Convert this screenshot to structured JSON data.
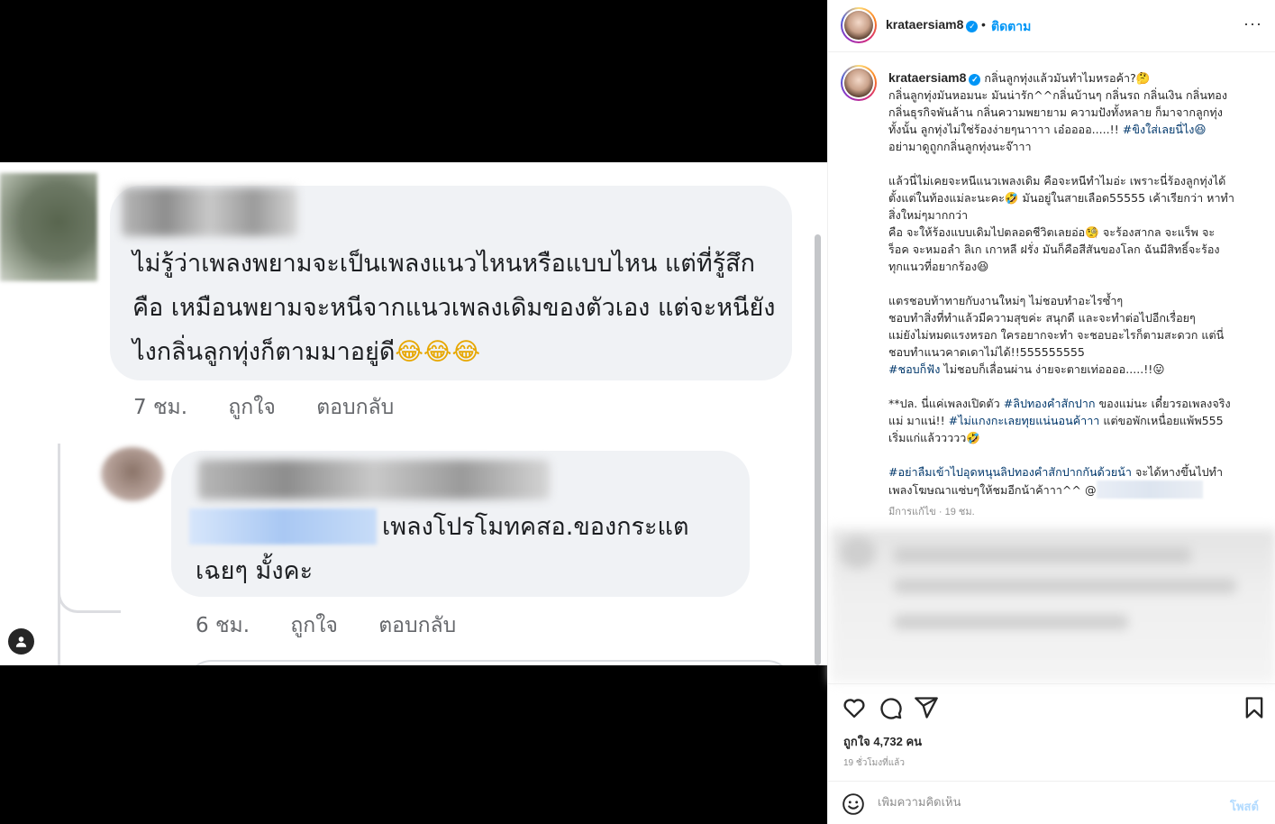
{
  "post_image": {
    "comment1": {
      "text": "ไม่รู้ว่าเพลงพยามจะเป็นเพลงแนวไหนหรือแบบไหน แต่ที่รู้สึกคือ เหมือนพยามจะหนีจากแนวเพลงเดิมของตัวเอง แต่จะหนียังไงกลิ่นลูกทุ่งก็ตามมาอยู่ดี",
      "emojis": "😂😂😂",
      "time": "7 ชม.",
      "like": "ถูกใจ",
      "reply": "ตอบกลับ"
    },
    "comment2": {
      "text": "เพลงโปรโมทคสอ.ของกระแต เฉยๆ มั้งคะ",
      "time": "6 ชม.",
      "like": "ถูกใจ",
      "reply": "ตอบกลับ"
    }
  },
  "header": {
    "username": "krataersiam8",
    "dot": "•",
    "follow_label": "ติดตาม",
    "more": "···"
  },
  "caption": {
    "username": "krataersiam8",
    "lines": [
      "กลิ่นลูกทุ่งแล้วมันทำไมหรอค้า?🤔",
      "กลิ่นลูกทุ่งมันหอมนะ มันน่ารัก^^กลิ่นบ้านๆ กลิ่นรถ กลิ่นเงิน กลิ่นทอง",
      "กลิ่นธุรกิจพันล้าน กลิ่นความพยายาม ความปังทั้งหลาย ก็มาจากลูกทุ่ง",
      "ทั้งนั้น ลูกทุ่งไม่ใช่ร้องง่ายๆนาาาา เอ๋ออออ.....!!",
      "อย่ามาดูถูกกลิ่นลูกทุ่งนะจ๊าาา",
      "แล้วนี่ไม่เคยจะหนีแนวเพลงเดิม คือจะหนีทำไมอ่ะ เพราะนี่ร้องลูกทุ่งได้",
      "ตั้งแต่ในท้องแม่ละนะคะ🤣 มันอยู่ในสายเลือด55555 เค้าเรียกว่า หาทำ",
      "สิ่งใหม่ๆมากกว่า",
      "คือ จะให้ร้องแบบเดิมไปตลอดชีวิตเลยอ่อ🧐 จะร้องสากล จะแร็พ จะ",
      "ร็อค จะหมอลำ ลิเก เกาหลี ฝรั่ง มันก็คือสีสันของโลก ฉันมีสิทธิ์จะร้อง",
      "ทุกแนวที่อยากร้อง😆",
      "แตรชอบท้าทายกับงานใหม่ๆ ไม่ชอบทำอะไรซ้ำๆ",
      "ชอบทำสิ่งที่ทำแล้วมีความสุขค่ะ สนุกดี และจะทำต่อไปอีกเรื่อยๆ",
      "แม่ยังไม่หมดแรงหรอก ใครอยากจะทำ จะชอบอะไรก็ตามสะดวก แต่นี่",
      "ชอบทำแนวคาดเดาไม่ได้!!555555555",
      "ไม่ชอบก็เลื่อนผ่าน ง่ายจะตายเท่ออออ.....!!😛",
      "**ปล. นี่แค่เพลงเปิดตัว",
      "ของแม่นะ เดี๋ยวรอเพลงจริง",
      "แม่ มาแน่!!",
      "แต่ขอพักเหนื่อยแพ้พ555",
      "เริ่มแก่แล้ววววว🤣",
      "จะได้หางขึ้นไปทำ",
      "เพลงโฆษณาแซ่บๆให้ชมอีกน้าค้าาา^^ @"
    ],
    "hashtags": {
      "h1": "#ขิงใส่เลยนี่ไง😆",
      "h2": "#ชอบก็ฟัง",
      "h3": "#ลิปทองคำสักปาก",
      "h4": "#ไม่แกงกะเลยทุยแน่นอนค้าาา",
      "h5": "#อย่าลืมเข้าไปอุดหนุนลิปทองคำสักปากกันด้วยน้า"
    },
    "edited": "มีการแก้ไข · 19 ชม."
  },
  "actions": {
    "likes": "ถูกใจ 4,732 คน",
    "time_ago": "19 ชั่วโมงที่แล้ว"
  },
  "comment_box": {
    "placeholder": "เพิ่มความคิดเห็น",
    "post_label": "โพสต์"
  },
  "colors": {
    "link_blue": "#0095f6",
    "hashtag": "#00376b",
    "bubble": "#f0f2f5"
  }
}
